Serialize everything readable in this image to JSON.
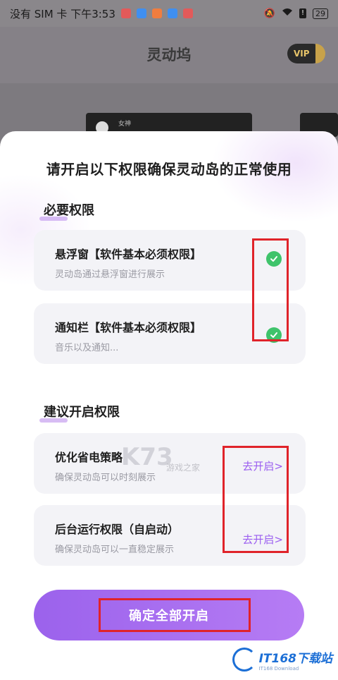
{
  "status_bar": {
    "carrier": "没有 SIM 卡 下午3:53",
    "battery": "29",
    "app_icons": [
      "#e25a5a",
      "#3f8ff0",
      "#f07d3f",
      "#3f8ff0",
      "#e25a5a"
    ]
  },
  "app": {
    "title": "灵动坞",
    "vip_label": "VIP",
    "bg_card_label": "女神"
  },
  "sheet": {
    "title": "请开启以下权限确保灵动岛的正常使用",
    "required_section": "必要权限",
    "recommended_section": "建议开启权限",
    "required_permissions": [
      {
        "name": "悬浮窗【软件基本必须权限】",
        "desc": "灵动岛通过悬浮窗进行展示",
        "granted": true
      },
      {
        "name": "通知栏【软件基本必须权限】",
        "desc": "音乐以及通知...",
        "granted": true
      }
    ],
    "recommended_permissions": [
      {
        "name": "优化省电策略",
        "desc": "确保灵动岛可以时刻展示",
        "action": "去开启>"
      },
      {
        "name": "后台运行权限（自启动）",
        "desc": "确保灵动岛可以一直稳定展示",
        "action": "去开启>"
      }
    ],
    "confirm_button": "确定全部开启"
  },
  "watermarks": {
    "k73": "K73",
    "center": "游戏之家",
    "logo_main": "IT168下载站",
    "logo_sub": "IT168 Download"
  },
  "colors": {
    "accent": "#9b62ec",
    "link": "#9a5cf0",
    "check": "#3fc36b",
    "annotation": "#e0232a"
  }
}
